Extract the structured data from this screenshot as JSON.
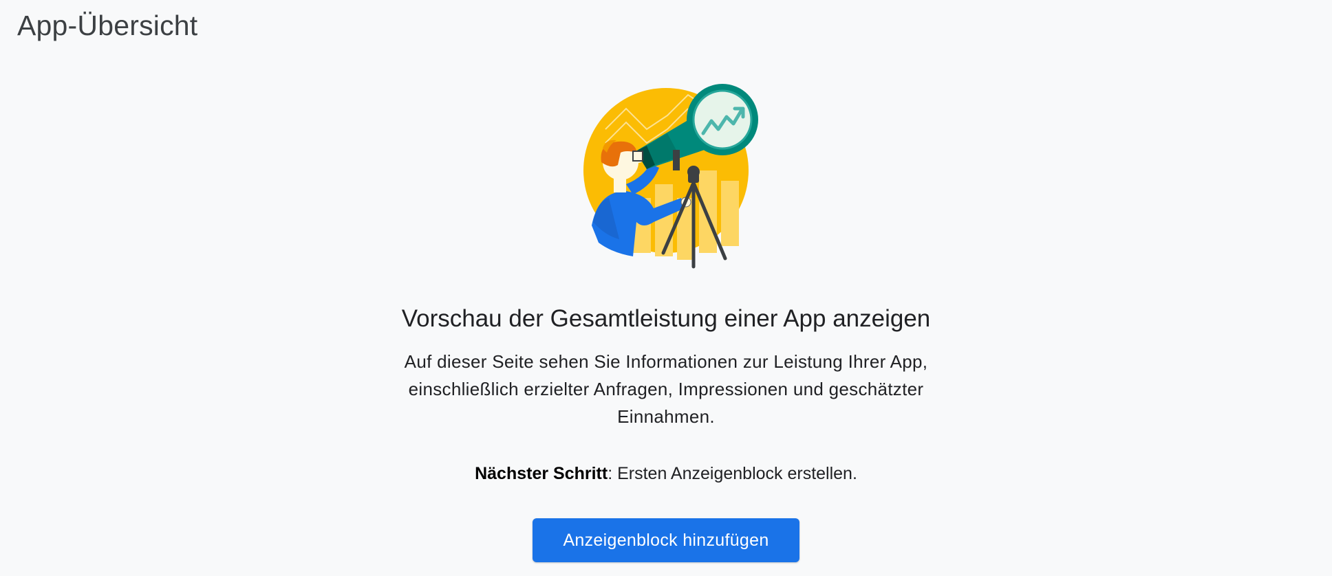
{
  "header": {
    "title": "App-Übersicht"
  },
  "illustration": {
    "icon": "telescope-analytics-illustration"
  },
  "main": {
    "headline": "Vorschau der Gesamtleistung einer App anzeigen",
    "description": "Auf dieser Seite sehen Sie Informationen zur Leistung Ihrer App, einschließlich erzielter Anfragen, Impressionen und geschätzter Einnahmen.",
    "next_step_label": "Nächster Schritt",
    "next_step_text": ": Ersten Anzeigenblock erstellen.",
    "button_label": "Anzeigenblock hinzufügen"
  },
  "colors": {
    "background": "#f8f9fa",
    "primary_button": "#1a73e8",
    "illustration_yellow": "#fbbc04",
    "illustration_teal": "#00897b"
  }
}
